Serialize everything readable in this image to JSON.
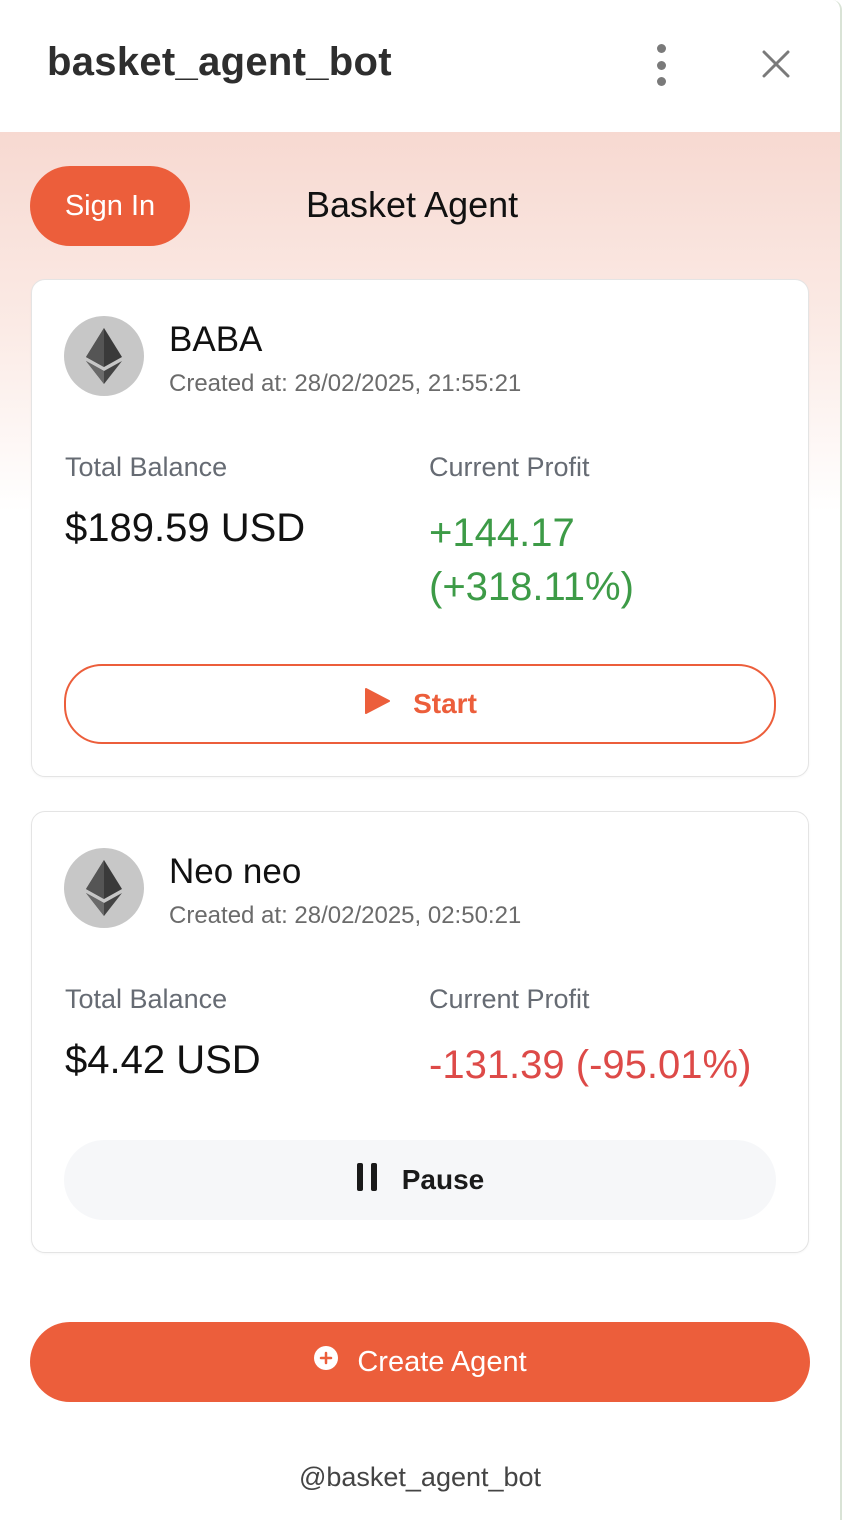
{
  "window": {
    "title": "basket_agent_bot"
  },
  "header": {
    "sign_in_label": "Sign In",
    "title": "Basket Agent"
  },
  "agents": [
    {
      "name": "BABA",
      "created": "Created at: 28/02/2025, 21:55:21",
      "balance_label": "Total Balance",
      "balance": "$189.59 USD",
      "profit_label": "Current Profit",
      "profit": "+144.17 (+318.11%)",
      "profit_status": "positive",
      "action_label": "Start",
      "action_icon": "play-icon",
      "avatar_icon": "ethereum-icon"
    },
    {
      "name": "Neo neo",
      "created": "Created at: 28/02/2025, 02:50:21",
      "balance_label": "Total Balance",
      "balance": "$4.42 USD",
      "profit_label": "Current Profit",
      "profit": "-131.39 (-95.01%)",
      "profit_status": "negative",
      "action_label": "Pause",
      "action_icon": "pause-icon",
      "avatar_icon": "ethereum-icon"
    }
  ],
  "create_button": {
    "label": "Create Agent",
    "icon": "plus-circle-icon"
  },
  "footer": {
    "handle": "@basket_agent_bot"
  },
  "colors": {
    "accent": "#ec5e3b",
    "positive": "#3d9b47",
    "negative": "#dd4a48",
    "muted_text": "#666b73"
  }
}
